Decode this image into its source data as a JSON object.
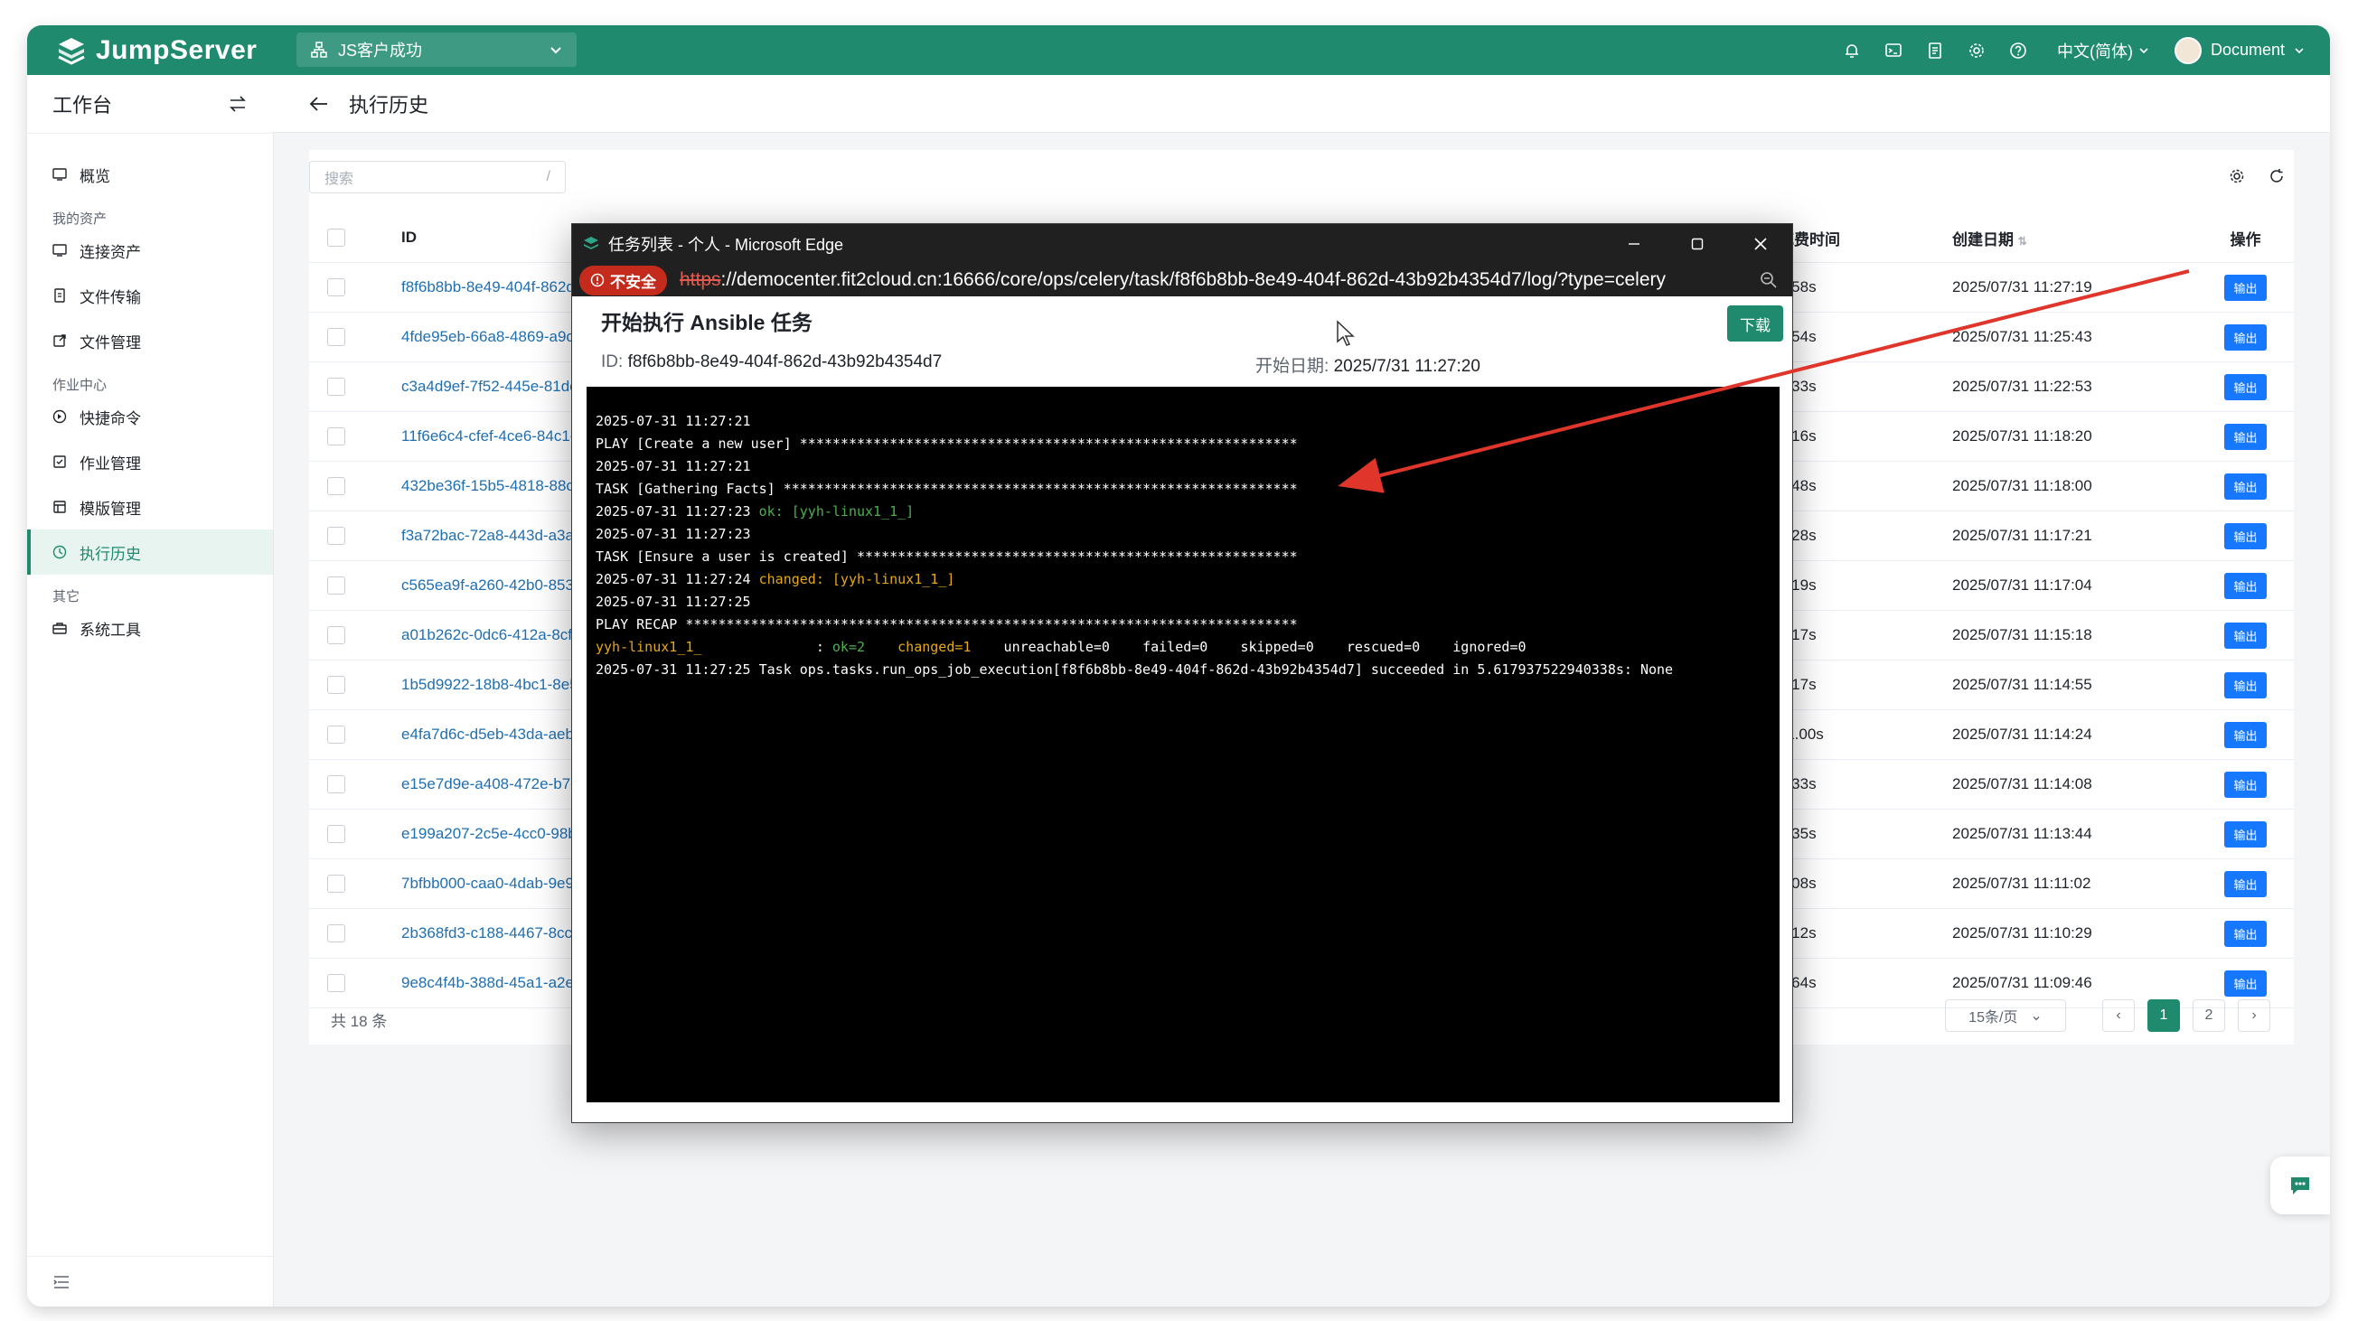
{
  "brand": {
    "logo_text": "JumpServer",
    "accent": "#1f8a6e"
  },
  "topbar": {
    "org": "JS客户成功",
    "language": "中文(简体)",
    "user": "Document"
  },
  "sidebar": {
    "title": "工作台",
    "groups": [
      {
        "label": "",
        "items": [
          {
            "label": "概览",
            "icon": "dashboard-icon"
          }
        ]
      },
      {
        "label": "我的资产",
        "items": [
          {
            "label": "连接资产",
            "icon": "monitor-icon"
          },
          {
            "label": "文件传输",
            "icon": "file-transfer-icon"
          },
          {
            "label": "文件管理",
            "icon": "file-manage-icon"
          }
        ]
      },
      {
        "label": "作业中心",
        "items": [
          {
            "label": "快捷命令",
            "icon": "quick-command-icon"
          },
          {
            "label": "作业管理",
            "icon": "job-icon"
          },
          {
            "label": "模版管理",
            "icon": "template-icon"
          },
          {
            "label": "执行历史",
            "icon": "history-icon",
            "active": true
          }
        ]
      },
      {
        "label": "其它",
        "items": [
          {
            "label": "系统工具",
            "icon": "toolbox-icon"
          }
        ]
      }
    ]
  },
  "page": {
    "title": "执行历史"
  },
  "search": {
    "placeholder": "搜索",
    "shortcut": "/"
  },
  "table": {
    "headers": {
      "id": "ID",
      "duration": "花费时间",
      "created": "创建日期",
      "actions": "操作"
    },
    "action_label": "输出",
    "rows": [
      {
        "id": "f8f6b8bb-8e49-404f-862d",
        "duration": "4.58s",
        "created": "2025/07/31 11:27:19"
      },
      {
        "id": "4fde95eb-66a8-4869-a9c7",
        "duration": "4.54s",
        "created": "2025/07/31 11:25:43"
      },
      {
        "id": "c3a4d9ef-7f52-445e-81dc",
        "duration": "4.33s",
        "created": "2025/07/31 11:22:53"
      },
      {
        "id": "11f6e6c4-cfef-4ce6-84c1-6",
        "duration": "1.16s",
        "created": "2025/07/31 11:18:20"
      },
      {
        "id": "432be36f-15b5-4818-88c5",
        "duration": "1.48s",
        "created": "2025/07/31 11:18:00"
      },
      {
        "id": "f3a72bac-72a8-443d-a3a1",
        "duration": "5.28s",
        "created": "2025/07/31 11:17:21"
      },
      {
        "id": "c565ea9f-a260-42b0-8537",
        "duration": "1.19s",
        "created": "2025/07/31 11:17:04"
      },
      {
        "id": "a01b262c-0dc6-412a-8cfb",
        "duration": "1.17s",
        "created": "2025/07/31 11:15:18"
      },
      {
        "id": "1b5d9922-18b8-4bc1-8e5",
        "duration": "1.17s",
        "created": "2025/07/31 11:14:55"
      },
      {
        "id": "e4fa7d6c-d5eb-43da-aeba",
        "duration": "11.00s",
        "created": "2025/07/31 11:14:24"
      },
      {
        "id": "e15e7d9e-a408-472e-b7e4",
        "duration": "4.33s",
        "created": "2025/07/31 11:14:08"
      },
      {
        "id": "e199a207-2c5e-4cc0-98be",
        "duration": "4.35s",
        "created": "2025/07/31 11:13:44"
      },
      {
        "id": "7bfbb000-caa0-4dab-9e96",
        "duration": "1.08s",
        "created": "2025/07/31 11:11:02"
      },
      {
        "id": "2b368fd3-c188-4467-8cc2",
        "duration": "1.12s",
        "created": "2025/07/31 11:10:29"
      },
      {
        "id": "9e8c4f4b-388d-45a1-a2e8",
        "duration": "1.64s",
        "created": "2025/07/31 11:09:46"
      }
    ],
    "total": "共 18 条"
  },
  "pagination": {
    "page_size": "15条/页",
    "pages": [
      "1",
      "2"
    ],
    "current": "1"
  },
  "popup": {
    "window_title": "任务列表 - 个人 - Microsoft Edge",
    "insecure_label": "不安全",
    "url_scheme": "https",
    "url_rest": "://democenter.fit2cloud.cn:16666/core/ops/celery/task/f8f6b8bb-8e49-404f-862d-43b92b4354d7/log/?type=celery",
    "task_title": "开始执行 Ansible 任务",
    "download_label": "下载",
    "id_label": "ID:",
    "id_value": "f8f6b8bb-8e49-404f-862d-43b92b4354d7",
    "date_label": "开始日期:",
    "date_value": "2025/7/31 11:27:20",
    "log": [
      {
        "text": "2025-07-31 11:27:21"
      },
      {
        "text": "PLAY [Create a new user] *************************************************************"
      },
      {
        "text": "2025-07-31 11:27:21"
      },
      {
        "text": "TASK [Gathering Facts] ***************************************************************"
      },
      {
        "text": "2025-07-31 11:27:23 ",
        "colored": "ok: [yyh-linux1_1_]",
        "color": "green"
      },
      {
        "text": "2025-07-31 11:27:23"
      },
      {
        "text": "TASK [Ensure a user is created] ******************************************************"
      },
      {
        "text": "2025-07-31 11:27:24 ",
        "colored": "changed: [yyh-linux1_1_]",
        "color": "yellow"
      },
      {
        "text": "2025-07-31 11:27:25"
      },
      {
        "text": "PLAY RECAP ***************************************************************************"
      },
      {
        "recap": true,
        "host": "yyh-linux1_1_",
        "sep": "              : ",
        "ok": "ok=2",
        "changed": "changed=1",
        "rest": "    unreachable=0    failed=0    skipped=0    rescued=0    ignored=0"
      },
      {
        "text": "2025-07-31 11:27:25 Task ops.tasks.run_ops_job_execution[f8f6b8bb-8e49-404f-862d-43b92b4354d7] succeeded in 5.617937522940338s: None"
      }
    ]
  }
}
